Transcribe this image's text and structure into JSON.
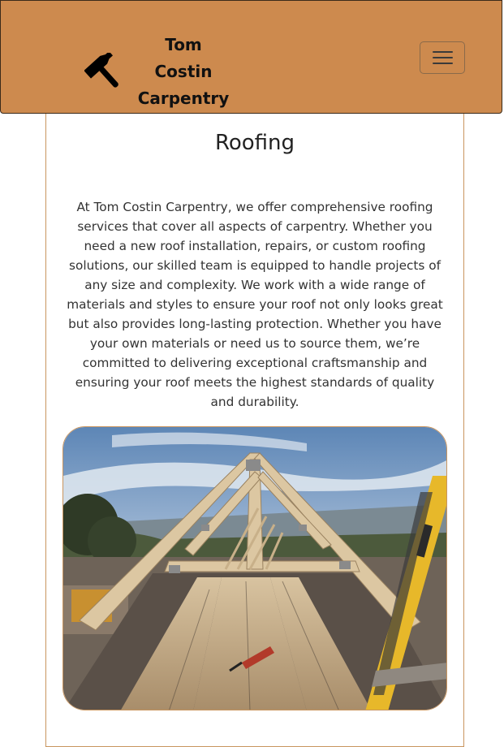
{
  "navbar": {
    "brand_line1": "Tom Costin",
    "brand_line2": "Carpentry",
    "brand_icon": "hammer-icon",
    "toggle_icon": "hamburger-icon",
    "bg_color": "#cd8a4e"
  },
  "main": {
    "title": "Roofing",
    "description": "At Tom Costin Carpentry, we offer comprehensive roofing services that cover all aspects of carpentry. Whether you need a new roof installation, repairs, or custom roofing solutions, our skilled team is equipped to handle projects of any size and complexity. We work with a wide range of materials and styles to ensure your roof not only looks great but also provides long-lasting protection. Whether you have your own materials or need us to source them, we’re committed to delivering exceptional craftsmanship and ensuring your roof meets the highest standards of quality and durability.",
    "photo": "roof-trusses-photo"
  }
}
